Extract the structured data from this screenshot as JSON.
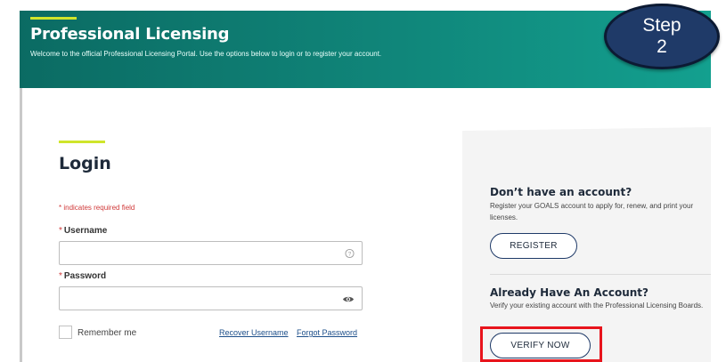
{
  "header": {
    "title": "Professional Licensing",
    "subtitle": "Welcome to the official Professional Licensing Portal. Use the options below to login or to register your account."
  },
  "step_badge": {
    "line1": "Step",
    "line2": "2"
  },
  "login": {
    "title": "Login",
    "required_note": "* indicates required field",
    "username_label": "Username",
    "password_label": "Password",
    "required_star": "*",
    "username_value": "",
    "password_value": "",
    "help_icon": "help-circle-icon",
    "reveal_icon": "eye-icon",
    "remember_label": "Remember me",
    "remember_checked": false,
    "recover_username": "Recover Username",
    "forgot_password": "Forgot Password"
  },
  "register_panel": {
    "heading": "Don’t have an account?",
    "text": "Register your GOALS account to apply for, renew, and print your licenses.",
    "button": "REGISTER"
  },
  "verify_panel": {
    "heading": "Already Have An Account?",
    "text": "Verify your existing account with the Professional Licensing Boards.",
    "button": "VERIFY NOW"
  },
  "colors": {
    "header_start": "#0b6b63",
    "header_end": "#13a08f",
    "accent_bar": "#cfe52b",
    "required_red": "#d03a3a",
    "link_blue": "#1d4f8a",
    "badge_fill": "#1f3a68",
    "highlight_red": "#e8141c"
  }
}
